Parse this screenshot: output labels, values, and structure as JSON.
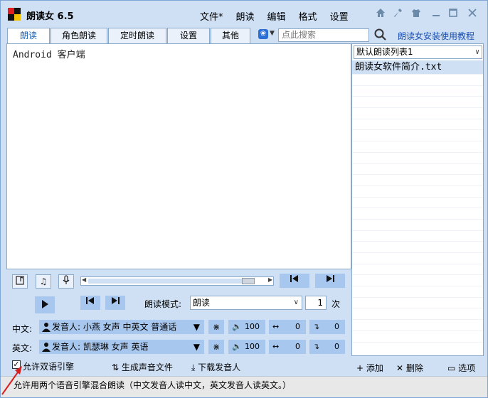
{
  "app": {
    "title": "朗读女 6.5",
    "menu": [
      "文件*",
      "朗读",
      "编辑",
      "格式",
      "设置"
    ]
  },
  "window_controls": [
    "home-icon",
    "tool-icon",
    "shirt-icon",
    "minimize-icon",
    "maximize-icon",
    "close-icon"
  ],
  "tabs": [
    {
      "label": "朗读",
      "active": true
    },
    {
      "label": "角色朗读"
    },
    {
      "label": "定时朗读"
    },
    {
      "label": "设置"
    },
    {
      "label": "其他"
    }
  ],
  "search": {
    "placeholder": "点此搜索"
  },
  "help_link": "朗读女安装使用教程",
  "editor": {
    "text": "Android 客户端"
  },
  "playlist": {
    "selected": "默认朗读列表1",
    "items": [
      "朗读女软件简介.txt"
    ]
  },
  "controls": {
    "mode_label": "朗读模式:",
    "mode_value": "朗读",
    "repeat_value": "1",
    "repeat_unit": "次",
    "progress": 0.94
  },
  "chinese": {
    "label": "中文:",
    "voice": "发音人: 小燕 女声 中英文 普通话",
    "volume": "100",
    "speed": "0",
    "pitch": "0"
  },
  "english": {
    "label": "英文:",
    "voice": "发音人: 凯瑟琳 女声 英语",
    "volume": "100",
    "speed": "0",
    "pitch": "0"
  },
  "bottom": {
    "dual_engine": "允许双语引擎",
    "dual_engine_checked": true,
    "generate_audio": "生成声音文件",
    "download_voice": "下载发音人",
    "add": "添加",
    "delete": "删除",
    "options": "选项"
  },
  "status": "允许用两个语音引擎混合朗读（中文发音人读中文，英文发音人读英文。）",
  "colors": {
    "accent": "#1a5fb4",
    "button_blue": "#a8c7ee",
    "frame": "#cfe0f5",
    "arrow_red": "#d62020"
  }
}
